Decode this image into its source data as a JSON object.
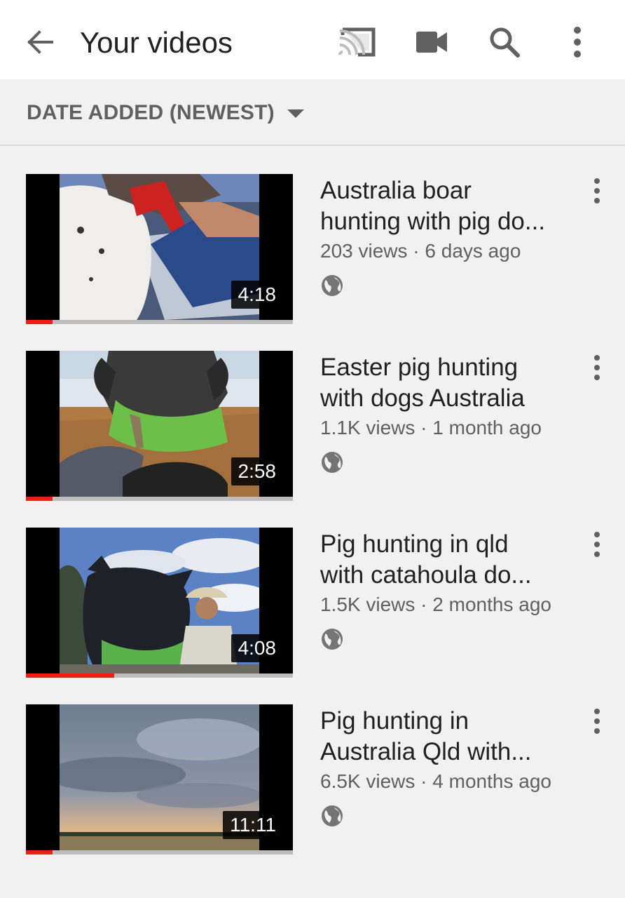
{
  "app_bar": {
    "title": "Your videos",
    "icons": [
      "back-arrow-icon",
      "cast-icon",
      "video-camera-icon",
      "search-icon",
      "more-vert-icon"
    ]
  },
  "sort": {
    "label": "DATE ADDED (NEWEST)",
    "icon": "dropdown-caret-icon"
  },
  "colors": {
    "progress_watched": "#e62117",
    "progress_track": "#bdbdbd",
    "text_primary": "#212121",
    "text_secondary": "#606060"
  },
  "videos": [
    {
      "title_line1": "Australia boar",
      "title_line2": "hunting with pig do...",
      "views": "203 views",
      "age": "6 days ago",
      "duration": "4:18",
      "watched_fraction": 0.1,
      "visibility_icon": "globe-icon"
    },
    {
      "title_line1": "Easter pig hunting",
      "title_line2": "with dogs Australia",
      "views": "1.1K views",
      "age": "1 month ago",
      "duration": "2:58",
      "watched_fraction": 0.1,
      "visibility_icon": "globe-icon"
    },
    {
      "title_line1": "Pig hunting in qld",
      "title_line2": "with catahoula do...",
      "views": "1.5K views",
      "age": "2 months ago",
      "duration": "4:08",
      "watched_fraction": 0.33,
      "visibility_icon": "globe-icon"
    },
    {
      "title_line1": "Pig hunting in",
      "title_line2": "Australia Qld with...",
      "views": "6.5K views",
      "age": "4 months ago",
      "duration": "11:11",
      "watched_fraction": 0.1,
      "visibility_icon": "globe-icon"
    }
  ]
}
